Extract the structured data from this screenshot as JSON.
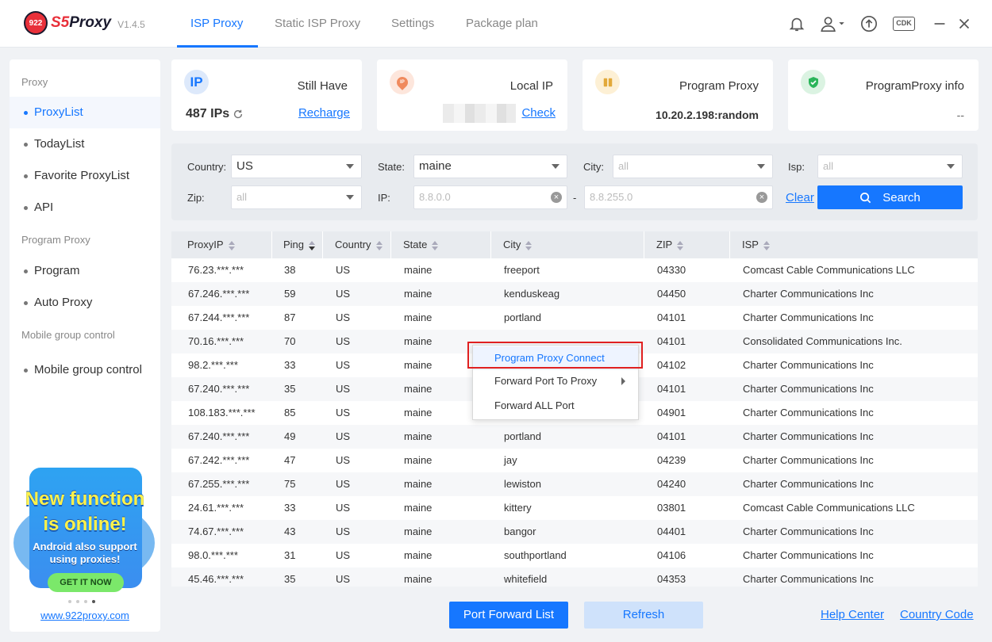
{
  "app": {
    "logo_badge": "922",
    "logo_s5": "S5",
    "logo_name": "Proxy",
    "version": "V1.4.5"
  },
  "nav": {
    "tabs": [
      "ISP Proxy",
      "Static ISP Proxy",
      "Settings",
      "Package plan"
    ],
    "active": "ISP Proxy",
    "cdk_label": "CDK"
  },
  "sidebar": {
    "section_proxy": "Proxy",
    "items_proxy": [
      "ProxyList",
      "TodayList",
      "Favorite ProxyList",
      "API"
    ],
    "section_program": "Program Proxy",
    "items_program": [
      "Program",
      "Auto Proxy"
    ],
    "section_mobile": "Mobile group control",
    "items_mobile": [
      "Mobile group control"
    ],
    "promo": {
      "line1": "New function",
      "line2": "is online!",
      "line3": "Android also support",
      "line4": "using proxies!",
      "button": "GET IT NOW"
    },
    "site_link": "www.922proxy.com"
  },
  "cards": {
    "still_have": {
      "icon": "IP",
      "title": "Still Have",
      "value": "487 IPs",
      "link": "Recharge"
    },
    "local_ip": {
      "icon": "IP",
      "title": "Local IP",
      "link": "Check"
    },
    "program_proxy": {
      "title": "Program Proxy",
      "value": "10.20.2.198:random"
    },
    "program_proxy_info": {
      "title": "ProgramProxy info",
      "value": "--"
    }
  },
  "filters": {
    "country_label": "Country:",
    "country_value": "US",
    "state_label": "State:",
    "state_value": "maine",
    "city_label": "City:",
    "city_placeholder": "all",
    "isp_label": "Isp:",
    "isp_placeholder": "all",
    "zip_label": "Zip:",
    "zip_placeholder": "all",
    "ip_label": "IP:",
    "ip_from": "8.8.0.0",
    "ip_to": "8.8.255.0",
    "ip_separator": "-",
    "clear": "Clear",
    "search": "Search"
  },
  "table": {
    "headers": [
      "ProxyIP",
      "Ping",
      "Country",
      "State",
      "City",
      "ZIP",
      "ISP"
    ],
    "rows": [
      [
        "76.23.***.***",
        "38",
        "US",
        "maine",
        "freeport",
        "04330",
        "Comcast Cable Communications LLC"
      ],
      [
        "67.246.***.***",
        "59",
        "US",
        "maine",
        "kenduskeag",
        "04450",
        "Charter Communications Inc"
      ],
      [
        "67.244.***.***",
        "87",
        "US",
        "maine",
        "portland",
        "04101",
        "Charter Communications Inc"
      ],
      [
        "70.16.***.***",
        "70",
        "US",
        "maine",
        "",
        "04101",
        "Consolidated Communications Inc."
      ],
      [
        "98.2.***.***",
        "33",
        "US",
        "maine",
        "",
        "04102",
        "Charter Communications Inc"
      ],
      [
        "67.240.***.***",
        "35",
        "US",
        "maine",
        "",
        "04101",
        "Charter Communications Inc"
      ],
      [
        "108.183.***.***",
        "85",
        "US",
        "maine",
        "",
        "04901",
        "Charter Communications Inc"
      ],
      [
        "67.240.***.***",
        "49",
        "US",
        "maine",
        "portland",
        "04101",
        "Charter Communications Inc"
      ],
      [
        "67.242.***.***",
        "47",
        "US",
        "maine",
        "jay",
        "04239",
        "Charter Communications Inc"
      ],
      [
        "67.255.***.***",
        "75",
        "US",
        "maine",
        "lewiston",
        "04240",
        "Charter Communications Inc"
      ],
      [
        "24.61.***.***",
        "33",
        "US",
        "maine",
        "kittery",
        "03801",
        "Comcast Cable Communications LLC"
      ],
      [
        "74.67.***.***",
        "43",
        "US",
        "maine",
        "bangor",
        "04401",
        "Charter Communications Inc"
      ],
      [
        "98.0.***.***",
        "31",
        "US",
        "maine",
        "southportland",
        "04106",
        "Charter Communications Inc"
      ],
      [
        "45.46.***.***",
        "35",
        "US",
        "maine",
        "whitefield",
        "04353",
        "Charter Communications Inc"
      ]
    ]
  },
  "context_menu": {
    "items": [
      "Program Proxy Connect",
      "Forward Port To Proxy",
      "Forward ALL Port"
    ]
  },
  "bottom": {
    "port_forward": "Port Forward List",
    "refresh": "Refresh",
    "help": "Help Center",
    "country_code": "Country Code"
  },
  "colors": {
    "accent": "#1677ff",
    "brand_red": "#e8303a",
    "highlight_outline": "#e02020"
  }
}
